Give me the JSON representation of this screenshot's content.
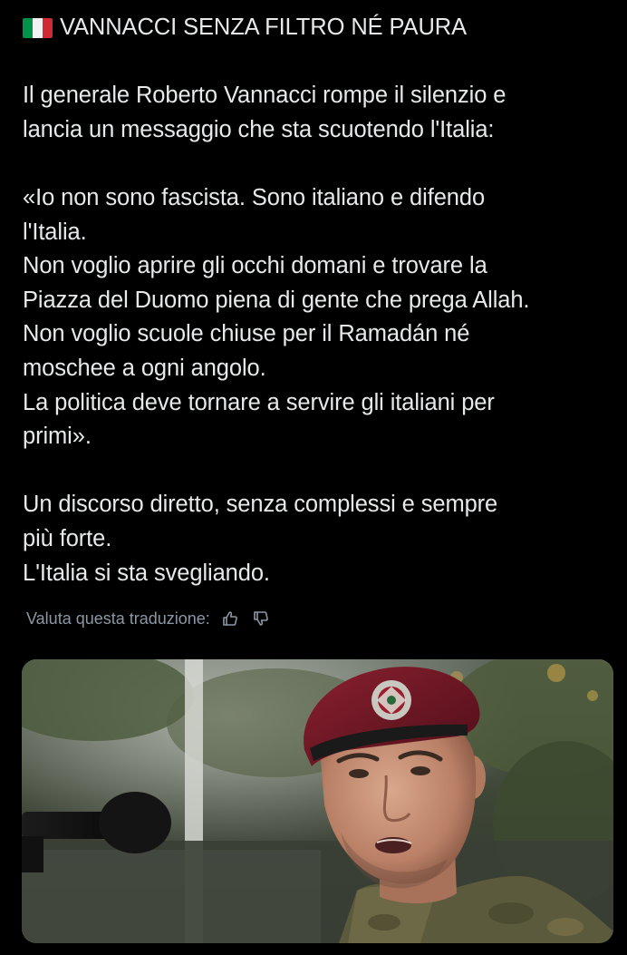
{
  "post": {
    "headline": "VANNACCI SENZA FILTRO NÉ PAURA",
    "flag_icon": "italy-flag-icon",
    "intro_lines": [
      "Il generale Roberto Vannacci rompe il silenzio e",
      "lancia un messaggio che sta scuotendo l'Italia:"
    ],
    "quote_lines": [
      "«Io non sono fascista. Sono italiano e difendo",
      "l'Italia.",
      "Non voglio aprire gli occhi domani e trovare la",
      "Piazza del Duomo piena di gente che prega Allah.",
      "Non voglio scuole chiuse per il Ramadán né",
      "moschee a ogni angolo.",
      "La politica deve tornare a servire gli italiani per",
      "primi»."
    ],
    "closing_lines": [
      "Un discorso diretto, senza complessi e sempre",
      "più forte.",
      "L'Italia si sta svegliando."
    ]
  },
  "translation": {
    "rate_label": "Valuta questa traduzione:",
    "thumbs_up_icon": "thumbs-up-icon",
    "thumbs_down_icon": "thumbs-down-icon"
  },
  "media": {
    "subject": "photo-of-man-in-maroon-beret-and-camouflage-uniform-speaking-into-microphone"
  },
  "colors": {
    "background": "#000000",
    "text": "#e7e9ea",
    "secondary_text": "#8b98a5",
    "beret": "#6e1420"
  }
}
